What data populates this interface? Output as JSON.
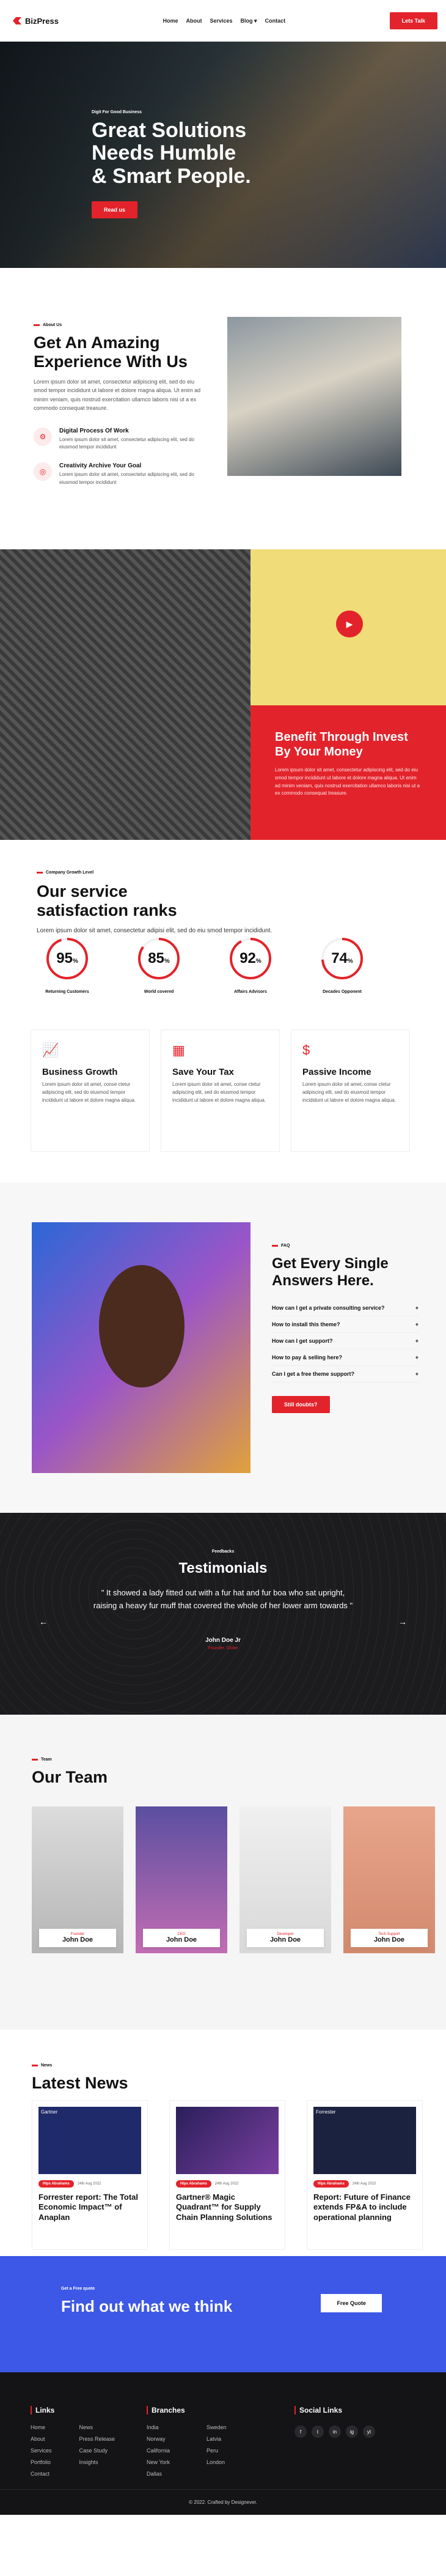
{
  "header": {
    "logo": "BizPress",
    "nav": [
      "Home",
      "About",
      "Services",
      "Blog",
      "Contact"
    ],
    "cta": "Lets Talk"
  },
  "hero": {
    "tag": "Digit For Good Business",
    "title": [
      "Great Solutions",
      "Needs Humble",
      "& Smart People."
    ],
    "button": "Read us"
  },
  "about": {
    "tag": "About Us",
    "title": "Get An Amazing Experience With Us",
    "text": "Lorem ipsum dolor sit amet, consectetur adipiscing elit, sed do eiu smod tempor incididunt ut labore et dolore magna aliqua. Ut enim ad minim veniam, quis nostrud exercitation ullamco laboris nisi ut a ex commodo consequat treasure.",
    "features": [
      {
        "title": "Digital Process Of Work",
        "text": "Lorem ipsum dolor sit amet, consectetur adipiscing elit, sed do eiusmod tempor incididunt"
      },
      {
        "title": "Creativity Archive Your Goal",
        "text": "Lorem ipsum dolor sit amet, consectetur adipiscing elit, sed do eiusmod tempor incididunt"
      }
    ]
  },
  "benefit": {
    "title": "Benefit Through Invest By Your Money",
    "text": "Lorem ipsum dolor sit amet, consectetur adipiscing elit, sed do eiu smod tempor incididunt ut labore et dolore magna aliqua. Ut enim ad minim veniam, quis nostrud exercitation ullamco laboris nisi ut a ex commodo consequat treasure."
  },
  "stats": {
    "tag": "Company Growth Level",
    "title": "Our service satisfaction ranks",
    "text": "Lorem ipsum dolor sit amet, consectetur adipisi elit, sed do eiu smod tempor incididunt.",
    "items": [
      {
        "value": "95",
        "unit": "%",
        "label": "Returning Customers",
        "percent": 95
      },
      {
        "value": "85",
        "unit": "%",
        "label": "World covered",
        "percent": 85
      },
      {
        "value": "92",
        "unit": "%",
        "label": "Affairs Advisors",
        "percent": 92
      },
      {
        "value": "74",
        "unit": "%",
        "label": "Decades Opponent",
        "percent": 74
      }
    ]
  },
  "services": [
    {
      "icon": "growth-chart-icon",
      "title": "Business Growth",
      "text": "Lorem ipsum dolor sit amet, conse ctetur adipiscing elit, sed do eiusmod tempor incididunt ut labore et dolore magna aliqua."
    },
    {
      "icon": "calculator-icon",
      "title": "Save Your Tax",
      "text": "Lorem ipsum dolor sit amet, conse ctetur adipiscing elit, sed do eiusmod tempor incididunt ut labore et dolore magna aliqua."
    },
    {
      "icon": "money-bag-icon",
      "title": "Passive Income",
      "text": "Lorem ipsum dolor sit amet, conse ctetur adipiscing elit, sed do eiusmod tempor incididunt ut labore et dolore magna aliqua."
    }
  ],
  "faq": {
    "tag": "FAQ",
    "title": "Get Every Single Answers Here.",
    "items": [
      "How can I get a private consulting service?",
      "How to install this theme?",
      "How can I get support?",
      "How to pay & selling here?",
      "Can I get a free theme support?"
    ],
    "button": "Still doubts?"
  },
  "testimonials": {
    "tag": "Feedbacks",
    "title": "Testimonials",
    "quote": "\" It showed a lady fitted out with a fur hat and fur boa who sat upright, raising a heavy fur muff that covered the whole of her lower arm towards \"",
    "name": "John Doe Jr",
    "role": "Founder, Globe"
  },
  "team": {
    "tag": "Team",
    "title": "Our Team",
    "members": [
      {
        "role": "Founder",
        "name": "John Doe"
      },
      {
        "role": "CEO",
        "name": "John Doe"
      },
      {
        "role": "Developer",
        "name": "John Doe"
      },
      {
        "role": "Tech Support",
        "name": "John Doe"
      }
    ]
  },
  "news": {
    "tag": "News",
    "title": "Latest News",
    "items": [
      {
        "cat": "Hips Abrahams",
        "date": "24th Aug 2022",
        "title": "Forrester report: The Total Economic Impact™ of Anaplan",
        "img": "Gartner"
      },
      {
        "cat": "Hips Abrahams",
        "date": "24th Aug 2022",
        "title": "Gartner® Magic Quadrant™ for Supply Chain Planning Solutions",
        "img": ""
      },
      {
        "cat": "Hips Abrahams",
        "date": "24th Aug 2022",
        "title": "Report: Future of Finance extends FP&A to include operational planning",
        "img": "Forrester"
      }
    ]
  },
  "cta": {
    "tag": "Get a Free quote",
    "title": "Find out what we think",
    "button": "Free Quote"
  },
  "footer": {
    "links_title": "Links",
    "links_col1": [
      "Home",
      "About",
      "Services",
      "Portfolio",
      "Contact"
    ],
    "links_col2": [
      "News",
      "Press Release",
      "Case Study",
      "Insights"
    ],
    "branches_title": "Branches",
    "branches_col1": [
      "India",
      "Norway",
      "California",
      "New York",
      "Dallas"
    ],
    "branches_col2": [
      "Sweden",
      "Latvia",
      "Peru",
      "London"
    ],
    "social_title": "Social Links",
    "social": [
      "f",
      "t",
      "in",
      "ig",
      "yt"
    ],
    "copyright": "© 2022. Crafted by Designever."
  }
}
